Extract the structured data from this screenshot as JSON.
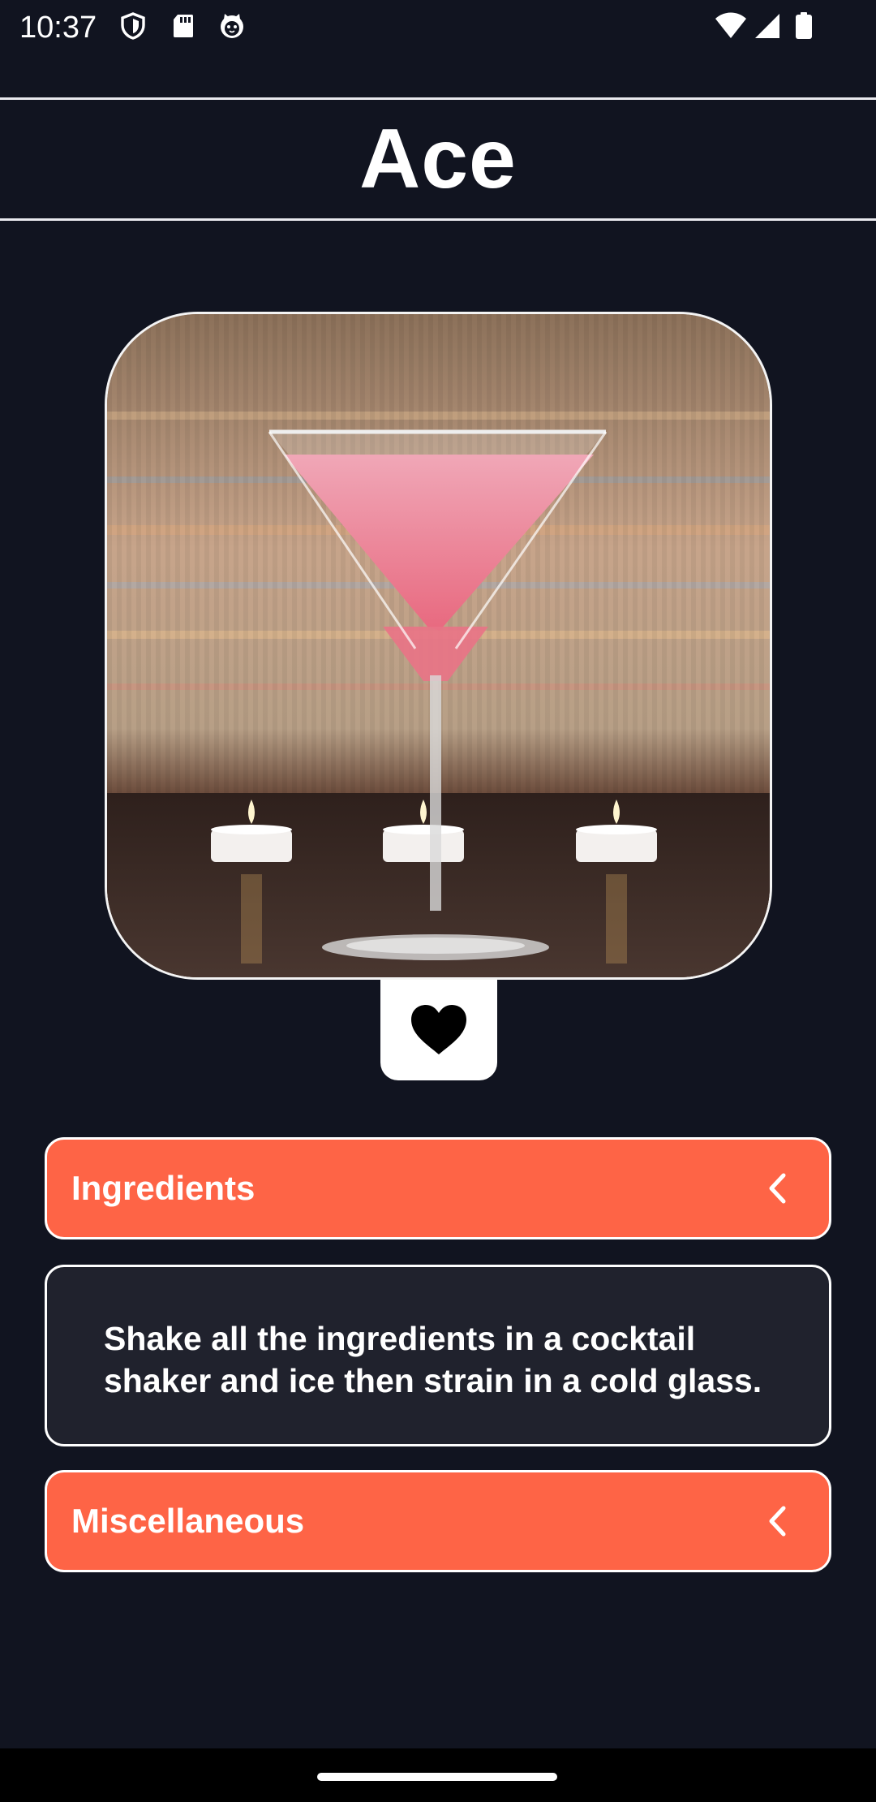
{
  "status_bar": {
    "time": "10:37",
    "left_icons": [
      "shield-icon",
      "sd-card-icon",
      "cat-face-icon"
    ],
    "right_icons": [
      "wifi-icon",
      "signal-icon",
      "battery-icon"
    ]
  },
  "header": {
    "title": "Ace"
  },
  "drink": {
    "image_icon": "cocktail-photo",
    "favorite_icon": "heart-icon",
    "favorited": true
  },
  "sections": {
    "ingredients_label": "Ingredients",
    "instructions_text": "Shake all the ingredients in a cocktail shaker and ice then strain in a cold glass.",
    "miscellaneous_label": "Miscellaneous",
    "chevron_icon": "chevron-left-icon"
  },
  "colors": {
    "background": "#111420",
    "accent": "#fe6446",
    "card": "#20222d",
    "border": "#ffffff"
  }
}
